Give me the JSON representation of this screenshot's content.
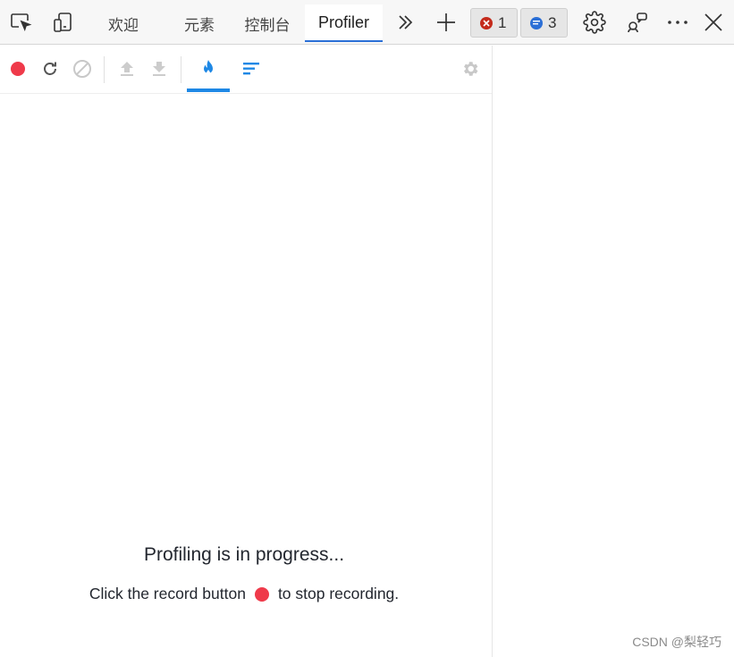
{
  "tabs": [
    {
      "label": "欢迎"
    },
    {
      "label": "元素"
    },
    {
      "label": "控制台"
    },
    {
      "label": "Profiler"
    }
  ],
  "badges": {
    "errors": "1",
    "messages": "3"
  },
  "icons": {
    "top": [
      "inspect-element-icon",
      "device-emulation-icon",
      "more-tabs-chevron-icon",
      "new-tab-plus-icon",
      "settings-gear-icon",
      "feedback-icon",
      "more-dots-icon",
      "close-icon"
    ],
    "profiler": [
      "record-icon",
      "reload-icon",
      "clear-icon",
      "upload-icon",
      "download-icon",
      "flame-chart-icon",
      "ranked-chart-icon",
      "profiler-settings-icon"
    ]
  },
  "colors": {
    "active_tab_underline": "#2b6fd6",
    "record_red": "#ef3a4a",
    "flame_blue": "#1e88e5",
    "error_badge": "#c42b1c",
    "message_badge": "#2b6fd6"
  },
  "profiler": {
    "status_title": "Profiling is in progress...",
    "hint_before": "Click the record button",
    "hint_after": "to stop recording."
  },
  "watermark": "CSDN @梨轻巧"
}
